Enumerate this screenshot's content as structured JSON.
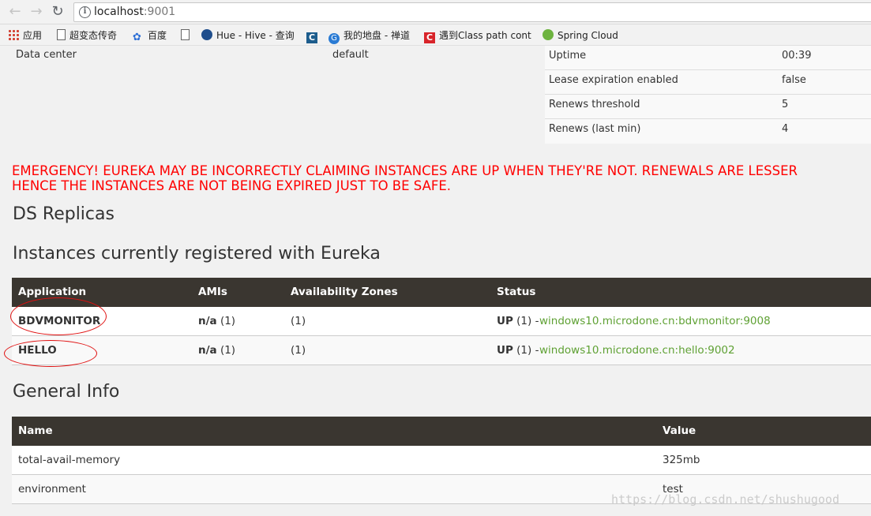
{
  "browser": {
    "url_host": "localhost",
    "url_port": ":9001",
    "bookmarks": [
      {
        "label": "应用",
        "icon": "apps-icon"
      },
      {
        "label": "超变态传奇",
        "icon": "page-icon"
      },
      {
        "label": "百度",
        "icon": "baidu-paw-icon"
      },
      {
        "label": "Hue - Hive - 查询",
        "icon": "page-icon"
      },
      {
        "label": "",
        "icon": "hue-icon"
      },
      {
        "label": "",
        "icon": "c-icon"
      },
      {
        "label": "我的地盘 - 禅道",
        "icon": "globe-icon"
      },
      {
        "label": "遇到Class path cont",
        "icon": "c-red-icon"
      },
      {
        "label": "Spring Cloud",
        "icon": "spring-icon"
      }
    ]
  },
  "environment": {
    "data_center_label": "Data center",
    "data_center_value": "default"
  },
  "status": [
    {
      "key": "Uptime",
      "value": "00:39"
    },
    {
      "key": "Lease expiration enabled",
      "value": "false"
    },
    {
      "key": "Renews threshold",
      "value": "5"
    },
    {
      "key": "Renews (last min)",
      "value": "4"
    }
  ],
  "emergency": {
    "line1": "EMERGENCY! EUREKA MAY BE INCORRECTLY CLAIMING INSTANCES ARE UP WHEN THEY'RE NOT. RENEWALS ARE LESSER",
    "line2": "HENCE THE INSTANCES ARE NOT BEING EXPIRED JUST TO BE SAFE."
  },
  "headings": {
    "ds_replicas": "DS Replicas",
    "instances": "Instances currently registered with Eureka",
    "general_info": "General Info"
  },
  "instances_table": {
    "headers": [
      "Application",
      "AMIs",
      "Availability Zones",
      "Status"
    ],
    "rows": [
      {
        "app": "BDVMONITOR",
        "amis_na": "n/a",
        "amis_count": "(1)",
        "zones": "(1)",
        "status_up": "UP",
        "status_count": "(1) -",
        "link": "windows10.microdone.cn:bdvmonitor:9008"
      },
      {
        "app": "HELLO",
        "amis_na": "n/a",
        "amis_count": "(1)",
        "zones": "(1)",
        "status_up": "UP",
        "status_count": "(1) -",
        "link": "windows10.microdone.cn:hello:9002"
      }
    ]
  },
  "general_table": {
    "headers": [
      "Name",
      "Value"
    ],
    "rows": [
      {
        "name": "total-avail-memory",
        "value": "325mb"
      },
      {
        "name": "environment",
        "value": "test"
      }
    ]
  },
  "watermark": "https://blog.csdn.net/shushugood",
  "colors": {
    "emergency": "#ff0000",
    "table_header": "#3a3630",
    "link": "#5fa134",
    "annotation_circle": "#e01010"
  }
}
